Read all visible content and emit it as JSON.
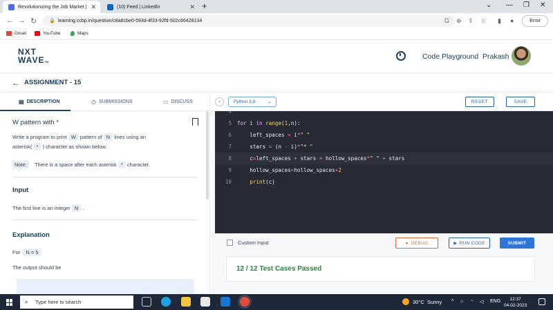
{
  "browser": {
    "tabs": [
      {
        "title": "Revolutionizing the Job Market |",
        "active": true
      },
      {
        "title": "(10) Feed | LinkedIn",
        "active": false
      }
    ],
    "url": "learning.ccbp.in/question/c8a8cbe0-593d-4f33-92fd-502c66428134",
    "error_label": "Error",
    "bookmarks": [
      "Gmail",
      "YouTube",
      "Maps"
    ]
  },
  "header": {
    "logo_line1": "NXT",
    "logo_line2": "WAVE",
    "logo_tm": "TM",
    "playground_label": "Code Playground",
    "user_name": "Prakash"
  },
  "assignment": {
    "title": "ASSIGNMENT - 15"
  },
  "left_tabs": [
    "DESCRIPTION",
    "SUBMISSIONS",
    "DISCUSS"
  ],
  "question": {
    "title": "W pattern with *",
    "p1_a": "Write a program to print",
    "p1_w": "W",
    "p1_b": "pattern of",
    "p1_n": "N",
    "p1_c": "lines using an",
    "p1_d": "asterisk(",
    "p1_star": "*",
    "p1_e": ") character as shown below.",
    "note_label": "Note:",
    "note_a": "There is a space after each asterisk",
    "note_star": "*",
    "note_b": "character.",
    "input_head": "Input",
    "input_a": "The first line is an integer",
    "input_n": "N",
    "input_dot": ".",
    "explanation_head": "Explanation",
    "for_label": "For",
    "for_value": "N = 5",
    "output_text": "The output should be"
  },
  "editor": {
    "language": "Python 3.9",
    "reset_label": "RESET",
    "save_label": "SAVE",
    "partial_line_no": "4",
    "lines": [
      {
        "no": "5",
        "text": "for i in range(1,n):"
      },
      {
        "no": "6",
        "text": "    left_spaces = i*\" \""
      },
      {
        "no": "7",
        "text": "    stars = (n - i)*\"* \""
      },
      {
        "no": "8",
        "text": "    c=left_spaces + stars + hollow_spaces*\" \" + stars"
      },
      {
        "no": "9",
        "text": "    hollow_spaces=hollow_spaces+2"
      },
      {
        "no": "10",
        "text": "    print(c)"
      }
    ]
  },
  "actions": {
    "custom_input_label": "Custom Input",
    "debug_label": "DEBUG",
    "run_label": "RUN CODE",
    "submit_label": "SUBMIT"
  },
  "result": {
    "text": "12 / 12 Test Cases Passed",
    "color": "#1f8a3a"
  },
  "taskbar": {
    "search_placeholder": "Type here to search",
    "weather_temp": "30°C",
    "weather_desc": "Sunny",
    "lang": "ENG",
    "time": "12:37",
    "date": "04-02-2023"
  },
  "colors": {
    "brand": "#183b56",
    "accent": "#2f75d8",
    "debug": "#e06a36",
    "editor_bg": "#272a34"
  }
}
